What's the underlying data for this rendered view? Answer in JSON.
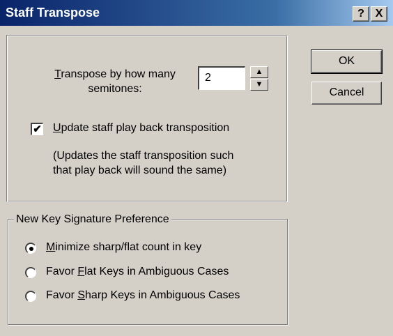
{
  "window": {
    "title": "Staff Transpose",
    "help_label": "?",
    "close_label": "X"
  },
  "transpose": {
    "label_line1_u": "T",
    "label_line1_rest": "ranspose by how many",
    "label_line2": "semitones:",
    "value": "2",
    "spin_up": "▲",
    "spin_down": "▼"
  },
  "update": {
    "checked": true,
    "check_mark": "✔",
    "label_u": "U",
    "label_rest": "pdate staff play back transposition",
    "note_line1": "(Updates the staff transposition such",
    "note_line2": "that play back will sound the same)"
  },
  "key_pref": {
    "group_label": "New Key Signature Preference",
    "options": [
      {
        "pre": "",
        "u": "M",
        "rest": "inimize sharp/flat count in key",
        "selected": true
      },
      {
        "pre": "Favor ",
        "u": "F",
        "rest": "lat Keys in Ambiguous Cases",
        "selected": false
      },
      {
        "pre": "Favor ",
        "u": "S",
        "rest": "harp Keys in Ambiguous Cases",
        "selected": false
      }
    ]
  },
  "buttons": {
    "ok": "OK",
    "cancel": "Cancel"
  }
}
